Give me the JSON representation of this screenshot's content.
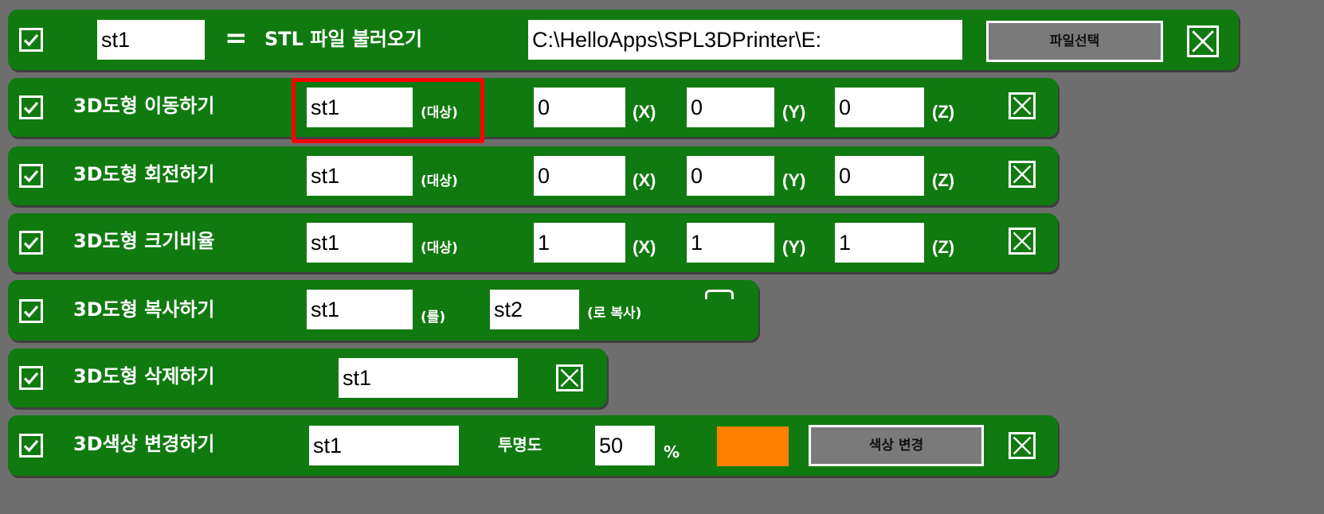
{
  "blocks": {
    "stl_load": {
      "target_value": "st1",
      "equals": "=",
      "title": "STL 파일 불러오기",
      "path_value": "C:\\HelloApps\\SPL3DPrinter\\E:",
      "file_button_label": "파일선택"
    },
    "move": {
      "title": "3D도형 이동하기",
      "target_value": "st1",
      "target_label": "(대상)",
      "x_value": "0",
      "x_label": "(X)",
      "y_value": "0",
      "y_label": "(Y)",
      "z_value": "0",
      "z_label": "(Z)"
    },
    "rotate": {
      "title": "3D도형 회전하기",
      "target_value": "st1",
      "target_label": "(대상)",
      "x_value": "0",
      "x_label": "(X)",
      "y_value": "0",
      "y_label": "(Y)",
      "z_value": "0",
      "z_label": "(Z)"
    },
    "scale": {
      "title": "3D도형 크기비율",
      "target_value": "st1",
      "target_label": "(대상)",
      "x_value": "1",
      "x_label": "(X)",
      "y_value": "1",
      "y_label": "(Y)",
      "z_value": "1",
      "z_label": "(Z)"
    },
    "copy": {
      "title": "3D도형 복사하기",
      "source_value": "st1",
      "source_label": "(를)",
      "dest_value": "st2",
      "dest_label": "(로 복사)"
    },
    "delete": {
      "title": "3D도형 삭제하기",
      "target_value": "st1"
    },
    "color": {
      "title": "3D색상 변경하기",
      "target_value": "st1",
      "opacity_label": "투명도",
      "opacity_value": "50",
      "percent_label": "%",
      "swatch_color": "#ff8000",
      "change_button_label": "색상 변경"
    }
  },
  "colors": {
    "block_green": "#107a10",
    "background": "#6e6e6e",
    "highlight": "#ff0000"
  },
  "icons": {
    "checkbox": "checkmark-icon",
    "remove": "close-x-icon"
  }
}
